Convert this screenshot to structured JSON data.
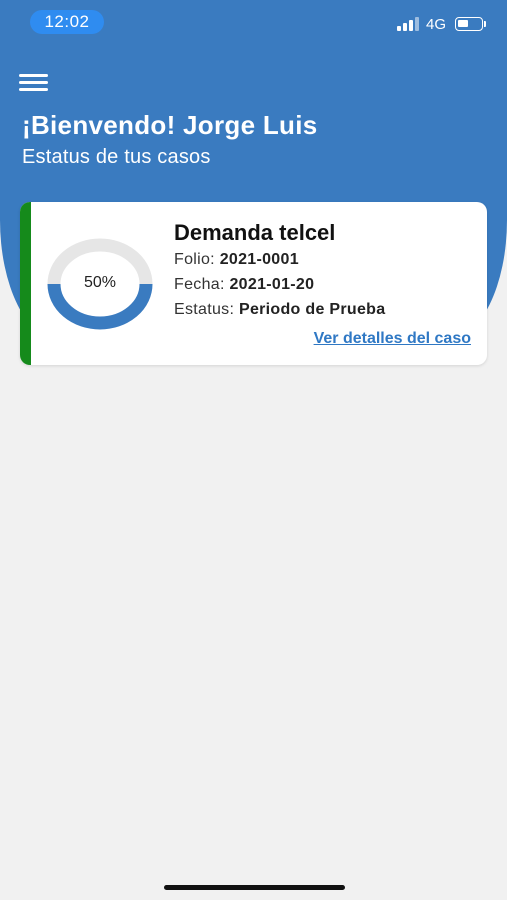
{
  "status_bar": {
    "time": "12:02",
    "network": "4G",
    "signal_icon": "cellular-signal-icon",
    "battery_icon": "battery-icon"
  },
  "header": {
    "menu_icon": "hamburger-menu-icon",
    "welcome": "¡Bienvendo! Jorge Luis",
    "subtitle": "Estatus de tus casos",
    "background_color": "#3a7bc0"
  },
  "cases": [
    {
      "title": "Demanda telcel",
      "progress_label": "50%",
      "progress": 0.5,
      "accent_color": "#158a1b",
      "folio_label": "Folio:",
      "folio_value": "2021-0001",
      "fecha_label": "Fecha:",
      "fecha_value": "2021-01-20",
      "estatus_label": "Estatus:",
      "estatus_value": "Periodo de Prueba",
      "details_link": "Ver detalles del caso"
    }
  ]
}
